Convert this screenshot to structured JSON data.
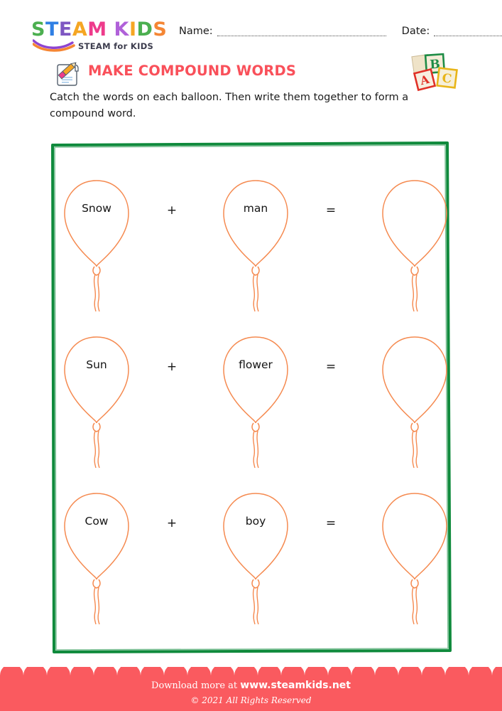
{
  "brand": {
    "wordmark_letters": [
      {
        "ch": "S",
        "color": "#4caf50"
      },
      {
        "ch": "T",
        "color": "#2f7fe4"
      },
      {
        "ch": "E",
        "color": "#7e57c2"
      },
      {
        "ch": "A",
        "color": "#f5a623"
      },
      {
        "ch": "M",
        "color": "#ee3b8b"
      },
      {
        "ch": " ",
        "color": "#ffffff"
      },
      {
        "ch": "K",
        "color": "#b061d9"
      },
      {
        "ch": "I",
        "color": "#f5a623"
      },
      {
        "ch": "D",
        "color": "#4caf50"
      },
      {
        "ch": "S",
        "color": "#f58634"
      }
    ],
    "tagline": "STEAM for KIDS",
    "swoosh_icon": "swoosh-icon",
    "tagline_color": "#3d3d4e"
  },
  "header": {
    "name_label": "Name:",
    "date_label": "Date:"
  },
  "title": {
    "text": "MAKE COMPOUND WORDS",
    "color": "#f9505a",
    "pencil_icon": "pencil-paper-icon",
    "blocks_icon": "abc-blocks-icon",
    "block_letters": [
      "B",
      "A",
      "C"
    ]
  },
  "instructions": {
    "text": "Catch the words on each balloon. Then write them together to form a compound word."
  },
  "frame": {
    "border_color": "#0f8a3c"
  },
  "balloons": {
    "outline_color": "#f58a50",
    "rows": [
      {
        "left_word": "Snow",
        "operator_1": "+",
        "middle_word": "man",
        "operator_2": "=",
        "answer_word": ""
      },
      {
        "left_word": "Sun",
        "operator_1": "+",
        "middle_word": "flower",
        "operator_2": "=",
        "answer_word": ""
      },
      {
        "left_word": "Cow",
        "operator_1": "+",
        "middle_word": "boy",
        "operator_2": "=",
        "answer_word": ""
      }
    ]
  },
  "footer": {
    "download_prefix": "Download more at",
    "website": "www.steamkids.net",
    "copyright": "© 2021 All Rights Reserved",
    "band_color": "#fa5a5f"
  }
}
